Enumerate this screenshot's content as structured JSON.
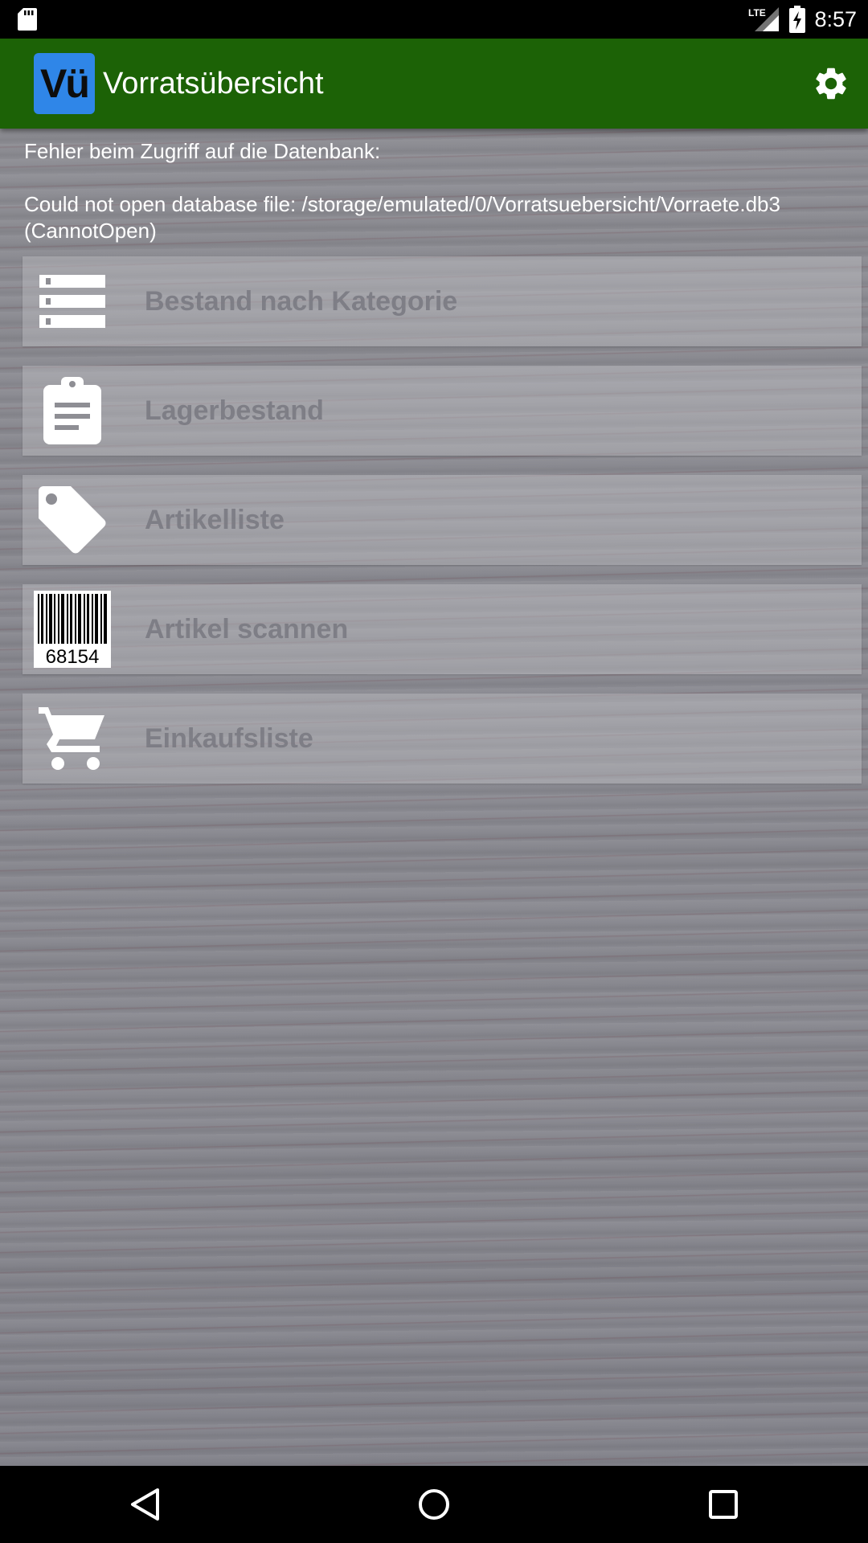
{
  "status_bar": {
    "time": "8:57",
    "network": "LTE",
    "icons": [
      "sd-card-icon",
      "lte-signal-icon",
      "battery-charging-icon"
    ]
  },
  "app_bar": {
    "logo_text": "Vü",
    "title": "Vorratsübersicht",
    "settings_icon": "gear-icon",
    "color": "#1c6206",
    "logo_color": "#2f86e8"
  },
  "error": {
    "heading": "Fehler beim Zugriff auf die Datenbank:",
    "message": "Could not open database file: /storage/emulated/0/Vorratsuebersicht/Vorraete.db3 (CannotOpen)"
  },
  "menu": {
    "items": [
      {
        "label": "Bestand nach Kategorie",
        "icon": "category-list-icon"
      },
      {
        "label": "Lagerbestand",
        "icon": "clipboard-icon"
      },
      {
        "label": "Artikelliste",
        "icon": "tag-icon"
      },
      {
        "label": "Artikel scannen",
        "icon": "barcode-icon",
        "barcode_number": "68154"
      },
      {
        "label": "Einkaufsliste",
        "icon": "shopping-cart-icon"
      }
    ]
  },
  "nav_bar": {
    "buttons": [
      "back-icon",
      "home-icon",
      "recents-icon"
    ]
  }
}
